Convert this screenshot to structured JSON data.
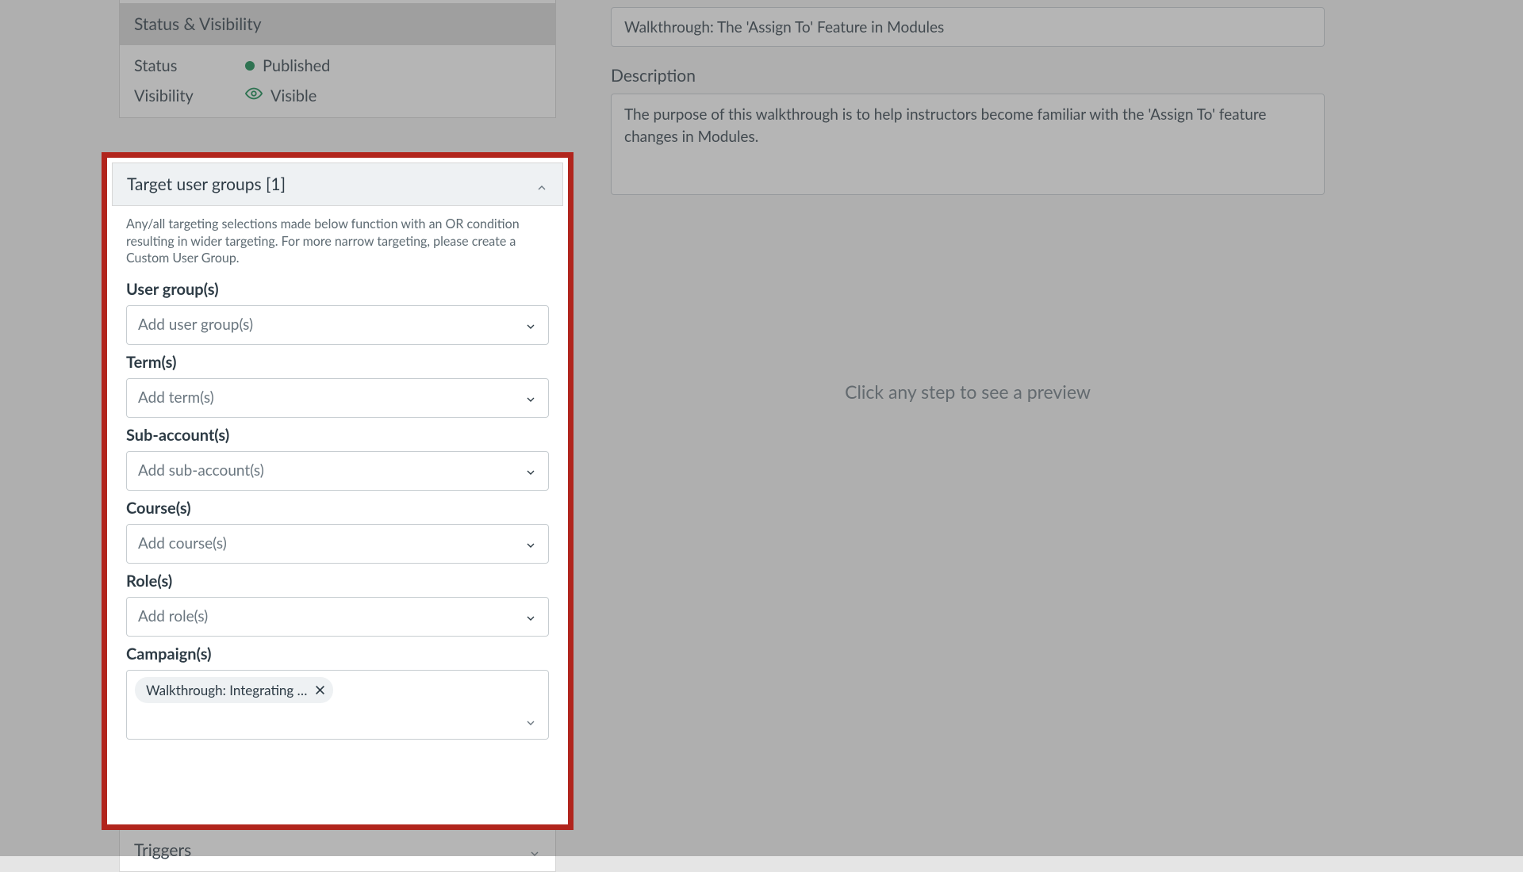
{
  "sidebar": {
    "statusVisibilityHeader": "Status & Visibility",
    "statusLabel": "Status",
    "statusValue": "Published",
    "visibilityLabel": "Visibility",
    "visibilityValue": "Visible"
  },
  "targetPanel": {
    "header": "Target user groups [1]",
    "helper": "Any/all targeting selections made below function with an OR condition resulting in wider targeting. For more narrow targeting, please create a Custom User Group.",
    "fields": {
      "userGroups": {
        "label": "User group(s)",
        "placeholder": "Add user group(s)"
      },
      "terms": {
        "label": "Term(s)",
        "placeholder": "Add term(s)"
      },
      "subAccounts": {
        "label": "Sub-account(s)",
        "placeholder": "Add sub-account(s)"
      },
      "courses": {
        "label": "Course(s)",
        "placeholder": "Add course(s)"
      },
      "roles": {
        "label": "Role(s)",
        "placeholder": "Add role(s)"
      },
      "campaigns": {
        "label": "Campaign(s)",
        "chip": "Walkthrough: Integrating …"
      }
    }
  },
  "triggers": {
    "label": "Triggers"
  },
  "right": {
    "titleValue": "Walkthrough: The 'Assign To' Feature in Modules",
    "descriptionLabel": "Description",
    "descriptionValue": "The purpose of this walkthrough is to help instructors become familiar with the 'Assign To' feature changes in Modules.",
    "previewHint": "Click any step to see a preview"
  }
}
